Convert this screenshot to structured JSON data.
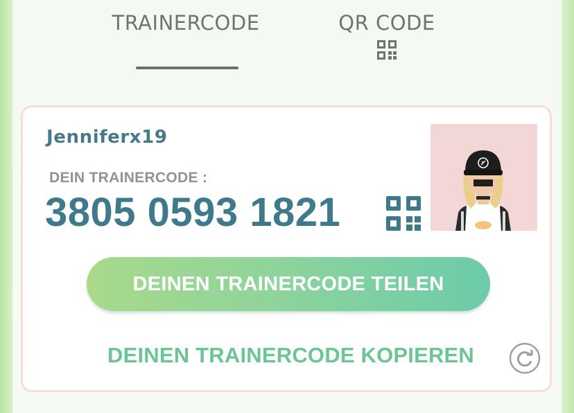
{
  "tabs": [
    {
      "label": "TRAINERCODE",
      "active": true
    },
    {
      "label": "QR CODE",
      "active": false,
      "icon": "qr-code-icon"
    }
  ],
  "profile": {
    "username": "Jenniferx19",
    "code_caption": "DEIN TRAINERCODE :",
    "trainer_code": "3805 0593 1821"
  },
  "actions": {
    "share_label": "DEINEN TRAINERCODE TEILEN",
    "copy_label": "DEINEN TRAINERCODE KOPIEREN",
    "refresh_icon": "refresh-icon"
  },
  "colors": {
    "accent_teal": "#3f7a8b",
    "accent_green": "#6cc595",
    "card_border": "#f7dcdc",
    "avatar_bg": "#f3d6d6"
  }
}
